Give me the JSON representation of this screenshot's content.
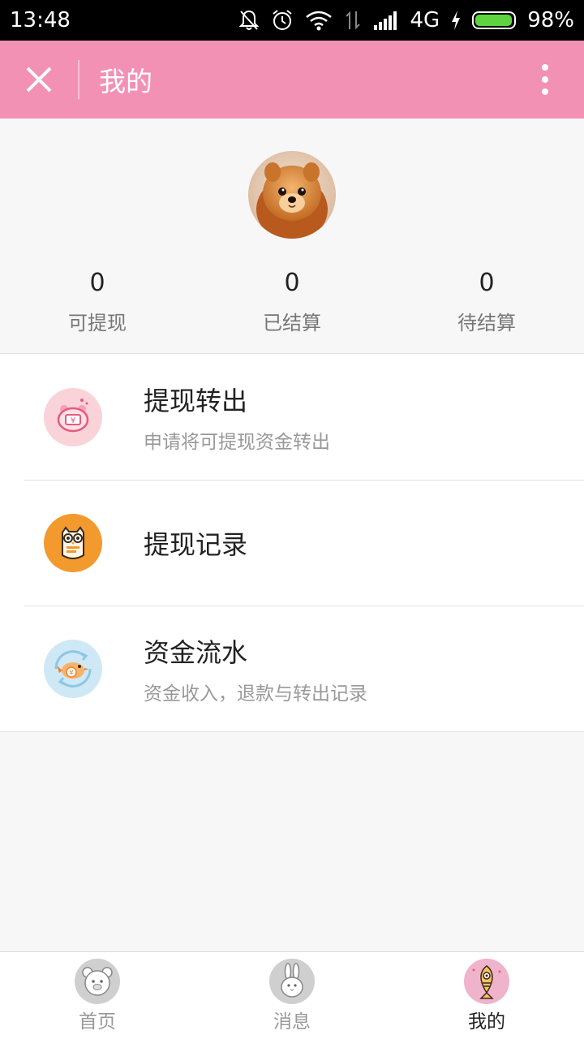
{
  "status_bar": {
    "time": "13:48",
    "network": "4G",
    "battery": "98%",
    "battery_level": 0.98,
    "icons": [
      "bell-off-icon",
      "alarm-icon",
      "wifi-icon",
      "data-arrows-icon",
      "signal-icon",
      "charging-icon",
      "battery-icon"
    ]
  },
  "app_bar": {
    "title": "我的",
    "close_icon": "close-icon",
    "more_icon": "more-vertical-icon",
    "bg_color": "#f291b4"
  },
  "profile": {
    "avatar": "pomeranian-avatar",
    "stats": [
      {
        "value": "0",
        "label": "可提现"
      },
      {
        "value": "0",
        "label": "已结算"
      },
      {
        "value": "0",
        "label": "待结算"
      }
    ]
  },
  "menu": {
    "items": [
      {
        "title": "提现转出",
        "subtitle": "申请将可提现资金转出",
        "icon": "piggy-bank-icon",
        "icon_color": "#f9d3d8"
      },
      {
        "title": "提现记录",
        "subtitle": "",
        "icon": "owl-icon",
        "icon_color": "#f29a2e"
      },
      {
        "title": "资金流水",
        "subtitle": "资金收入，退款与转出记录",
        "icon": "bird-coin-icon",
        "icon_color": "#cfe8f5"
      }
    ]
  },
  "tab_bar": {
    "tabs": [
      {
        "label": "首页",
        "icon": "bear-icon",
        "active": false
      },
      {
        "label": "消息",
        "icon": "rabbit-icon",
        "active": false
      },
      {
        "label": "我的",
        "icon": "fish-icon",
        "active": true
      }
    ]
  }
}
